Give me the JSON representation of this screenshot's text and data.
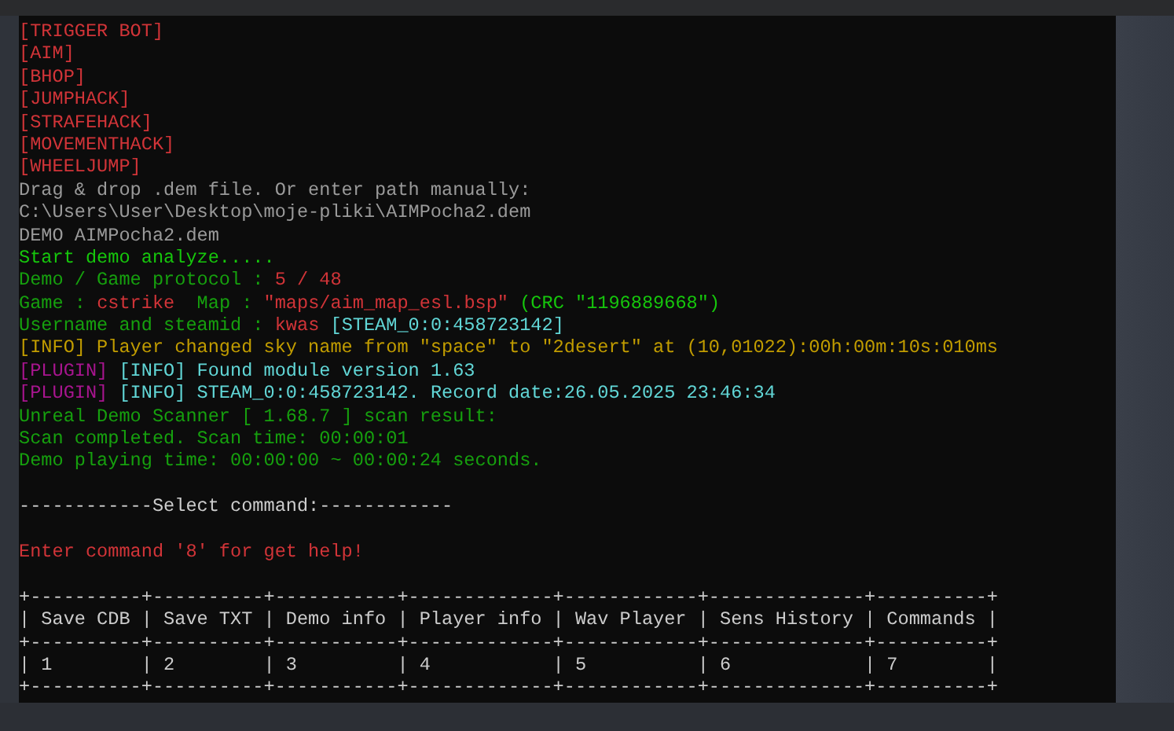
{
  "console": {
    "lines": [
      {
        "kind": "text",
        "segments": [
          {
            "text": "[TRIGGER BOT]",
            "color": "#d13438"
          }
        ]
      },
      {
        "kind": "text",
        "segments": [
          {
            "text": "[AIM]",
            "color": "#d13438"
          }
        ]
      },
      {
        "kind": "text",
        "segments": [
          {
            "text": "[BHOP]",
            "color": "#d13438"
          }
        ]
      },
      {
        "kind": "text",
        "segments": [
          {
            "text": "[JUMPHACK]",
            "color": "#d13438"
          }
        ]
      },
      {
        "kind": "text",
        "segments": [
          {
            "text": "[STRAFEHACK]",
            "color": "#d13438"
          }
        ]
      },
      {
        "kind": "text",
        "segments": [
          {
            "text": "[MOVEMENTHACK]",
            "color": "#d13438"
          }
        ]
      },
      {
        "kind": "text",
        "segments": [
          {
            "text": "[WHEELJUMP]",
            "color": "#d13438"
          }
        ]
      },
      {
        "kind": "text",
        "segments": [
          {
            "text": "Drag & drop .dem file. Or enter path manually:",
            "color": "#9a9a9a"
          }
        ]
      },
      {
        "kind": "text",
        "segments": [
          {
            "text": "C:\\Users\\User\\Desktop\\moje-pliki\\AIMPocha2.dem",
            "color": "#9a9a9a"
          }
        ]
      },
      {
        "kind": "text",
        "segments": [
          {
            "text": "DEMO AIMPocha2.dem",
            "color": "#9a9a9a"
          }
        ]
      },
      {
        "kind": "text",
        "segments": [
          {
            "text": "Start demo analyze.....",
            "color": "#16c60c"
          }
        ]
      },
      {
        "kind": "text",
        "segments": [
          {
            "text": "Demo / Game protocol : ",
            "color": "#16a00e"
          },
          {
            "text": "5 / 48",
            "color": "#d13438"
          }
        ]
      },
      {
        "kind": "text",
        "segments": [
          {
            "text": "Game : ",
            "color": "#16a00e"
          },
          {
            "text": "cstrike",
            "color": "#d13438"
          },
          {
            "text": "  Map : ",
            "color": "#16a00e"
          },
          {
            "text": "\"maps/aim_map_esl.bsp\"",
            "color": "#d13438"
          },
          {
            "text": " (CRC \"1196889668\")",
            "color": "#16c60c"
          }
        ]
      },
      {
        "kind": "text",
        "segments": [
          {
            "text": "Username and steamid : ",
            "color": "#16a00e"
          },
          {
            "text": "kwas",
            "color": "#d13438"
          },
          {
            "text": " [STEAM_0:0:458723142]",
            "color": "#61d6d6"
          }
        ]
      },
      {
        "kind": "text",
        "segments": [
          {
            "text": "[INFO] Player changed sky name from \"space\" to \"2desert\" at (10,01022):00h:00m:10s:010ms",
            "color": "#c19c00"
          }
        ]
      },
      {
        "kind": "text",
        "segments": [
          {
            "text": "[PLUGIN]",
            "color": "#a8158f"
          },
          {
            "text": " [INFO] Found module version 1.63",
            "color": "#61d6d6"
          }
        ]
      },
      {
        "kind": "text",
        "segments": [
          {
            "text": "[PLUGIN]",
            "color": "#a8158f"
          },
          {
            "text": " [INFO] STEAM_0:0:458723142. Record date:26.05.2025 23:46:34",
            "color": "#61d6d6"
          }
        ]
      },
      {
        "kind": "text",
        "segments": [
          {
            "text": "Unreal Demo Scanner [ 1.68.7 ] scan result:",
            "color": "#16a00e"
          }
        ]
      },
      {
        "kind": "text",
        "segments": [
          {
            "text": "Scan completed. Scan time: 00:00:01",
            "color": "#16a00e"
          }
        ]
      },
      {
        "kind": "text",
        "segments": [
          {
            "text": "Demo playing time: 00:00:00 ~ 00:00:24 seconds.",
            "color": "#16a00e"
          }
        ]
      },
      {
        "kind": "blank"
      },
      {
        "kind": "text",
        "segments": [
          {
            "text": "------------Select command:------------",
            "color": "#cccccc"
          }
        ]
      },
      {
        "kind": "blank"
      },
      {
        "kind": "text",
        "segments": [
          {
            "text": "Enter command '8' for get help!",
            "color": "#d13438"
          }
        ]
      },
      {
        "kind": "blank"
      },
      {
        "kind": "text",
        "segments": [
          {
            "text": "+----------+----------+-----------+-------------+------------+--------------+----------+",
            "color": "#cccccc"
          }
        ]
      },
      {
        "kind": "text",
        "segments": [
          {
            "text": "| Save CDB | Save TXT | Demo info | Player info | Wav Player | Sens History | Commands |",
            "color": "#cccccc"
          }
        ]
      },
      {
        "kind": "text",
        "segments": [
          {
            "text": "+----------+----------+-----------+-------------+------------+--------------+----------+",
            "color": "#cccccc"
          }
        ]
      },
      {
        "kind": "text",
        "segments": [
          {
            "text": "| 1        | 2        | 3         | 4           | 5          | 6            | 7        |",
            "color": "#cccccc"
          }
        ]
      },
      {
        "kind": "text",
        "segments": [
          {
            "text": "+----------+----------+-----------+-------------+------------+--------------+----------+",
            "color": "#cccccc"
          }
        ]
      }
    ]
  }
}
